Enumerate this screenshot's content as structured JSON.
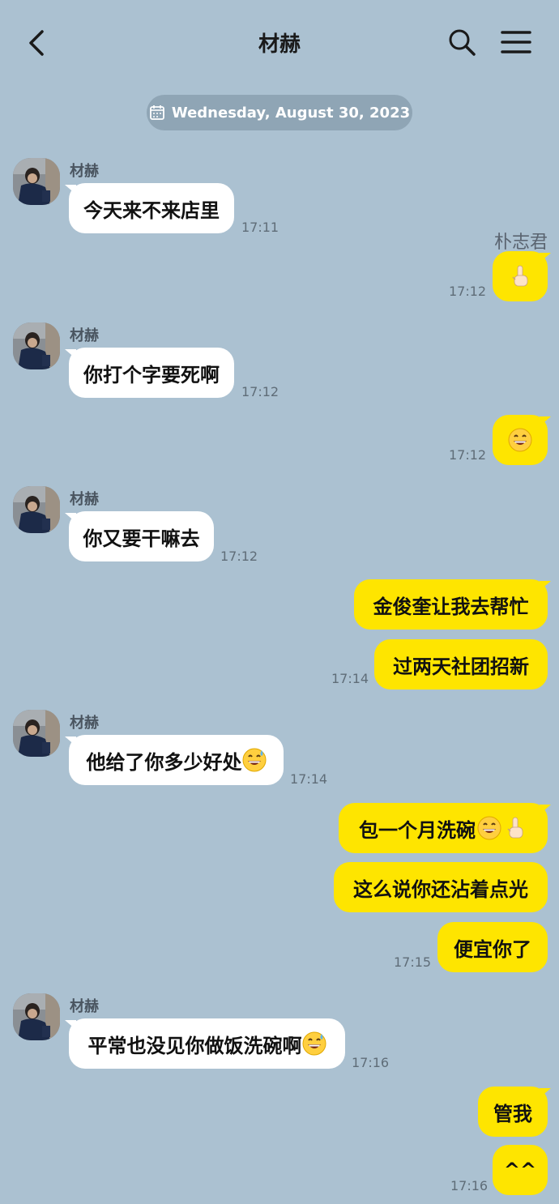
{
  "header": {
    "title": "材赫",
    "back_icon": "chevron-left-icon",
    "search_icon": "search-icon",
    "menu_icon": "hamburger-menu-icon"
  },
  "date_divider": {
    "text": "Wednesday, August 30, 2023",
    "icon": "calendar-icon"
  },
  "me": {
    "name": "朴志君"
  },
  "colors": {
    "background": "#abc1d1",
    "outgoing": "#fee500",
    "incoming": "#ffffff"
  },
  "messages": [
    {
      "sender": "材赫",
      "text": "今天来不来店里",
      "time": "17:11"
    },
    {
      "sender": "me",
      "emoji": "pointing-up-emoji",
      "time": "17:12"
    },
    {
      "sender": "材赫",
      "text": "你打个字要死啊",
      "time": "17:12"
    },
    {
      "sender": "me",
      "emoji": "grinning-face-emoji",
      "time": "17:12"
    },
    {
      "sender": "材赫",
      "text": "你又要干嘛去",
      "time": "17:12"
    },
    {
      "sender": "me",
      "text": "金俊奎让我去帮忙"
    },
    {
      "sender": "me",
      "text": "过两天社团招新",
      "time": "17:14"
    },
    {
      "sender": "材赫",
      "text": "他给了你多少好处",
      "emoji": "sweat-smile-emoji",
      "time": "17:14"
    },
    {
      "sender": "me",
      "text": "包一个月洗碗",
      "emoji": "grinning-face-and-pointing-up-emoji"
    },
    {
      "sender": "me",
      "text": "这么说你还沾着点光"
    },
    {
      "sender": "me",
      "text": "便宜你了",
      "time": "17:15"
    },
    {
      "sender": "材赫",
      "text": "平常也没见你做饭洗碗啊",
      "emoji": "sweat-smile-emoji",
      "time": "17:16"
    },
    {
      "sender": "me",
      "text": "管我"
    },
    {
      "sender": "me",
      "text": "^^",
      "time": "17:16"
    }
  ]
}
